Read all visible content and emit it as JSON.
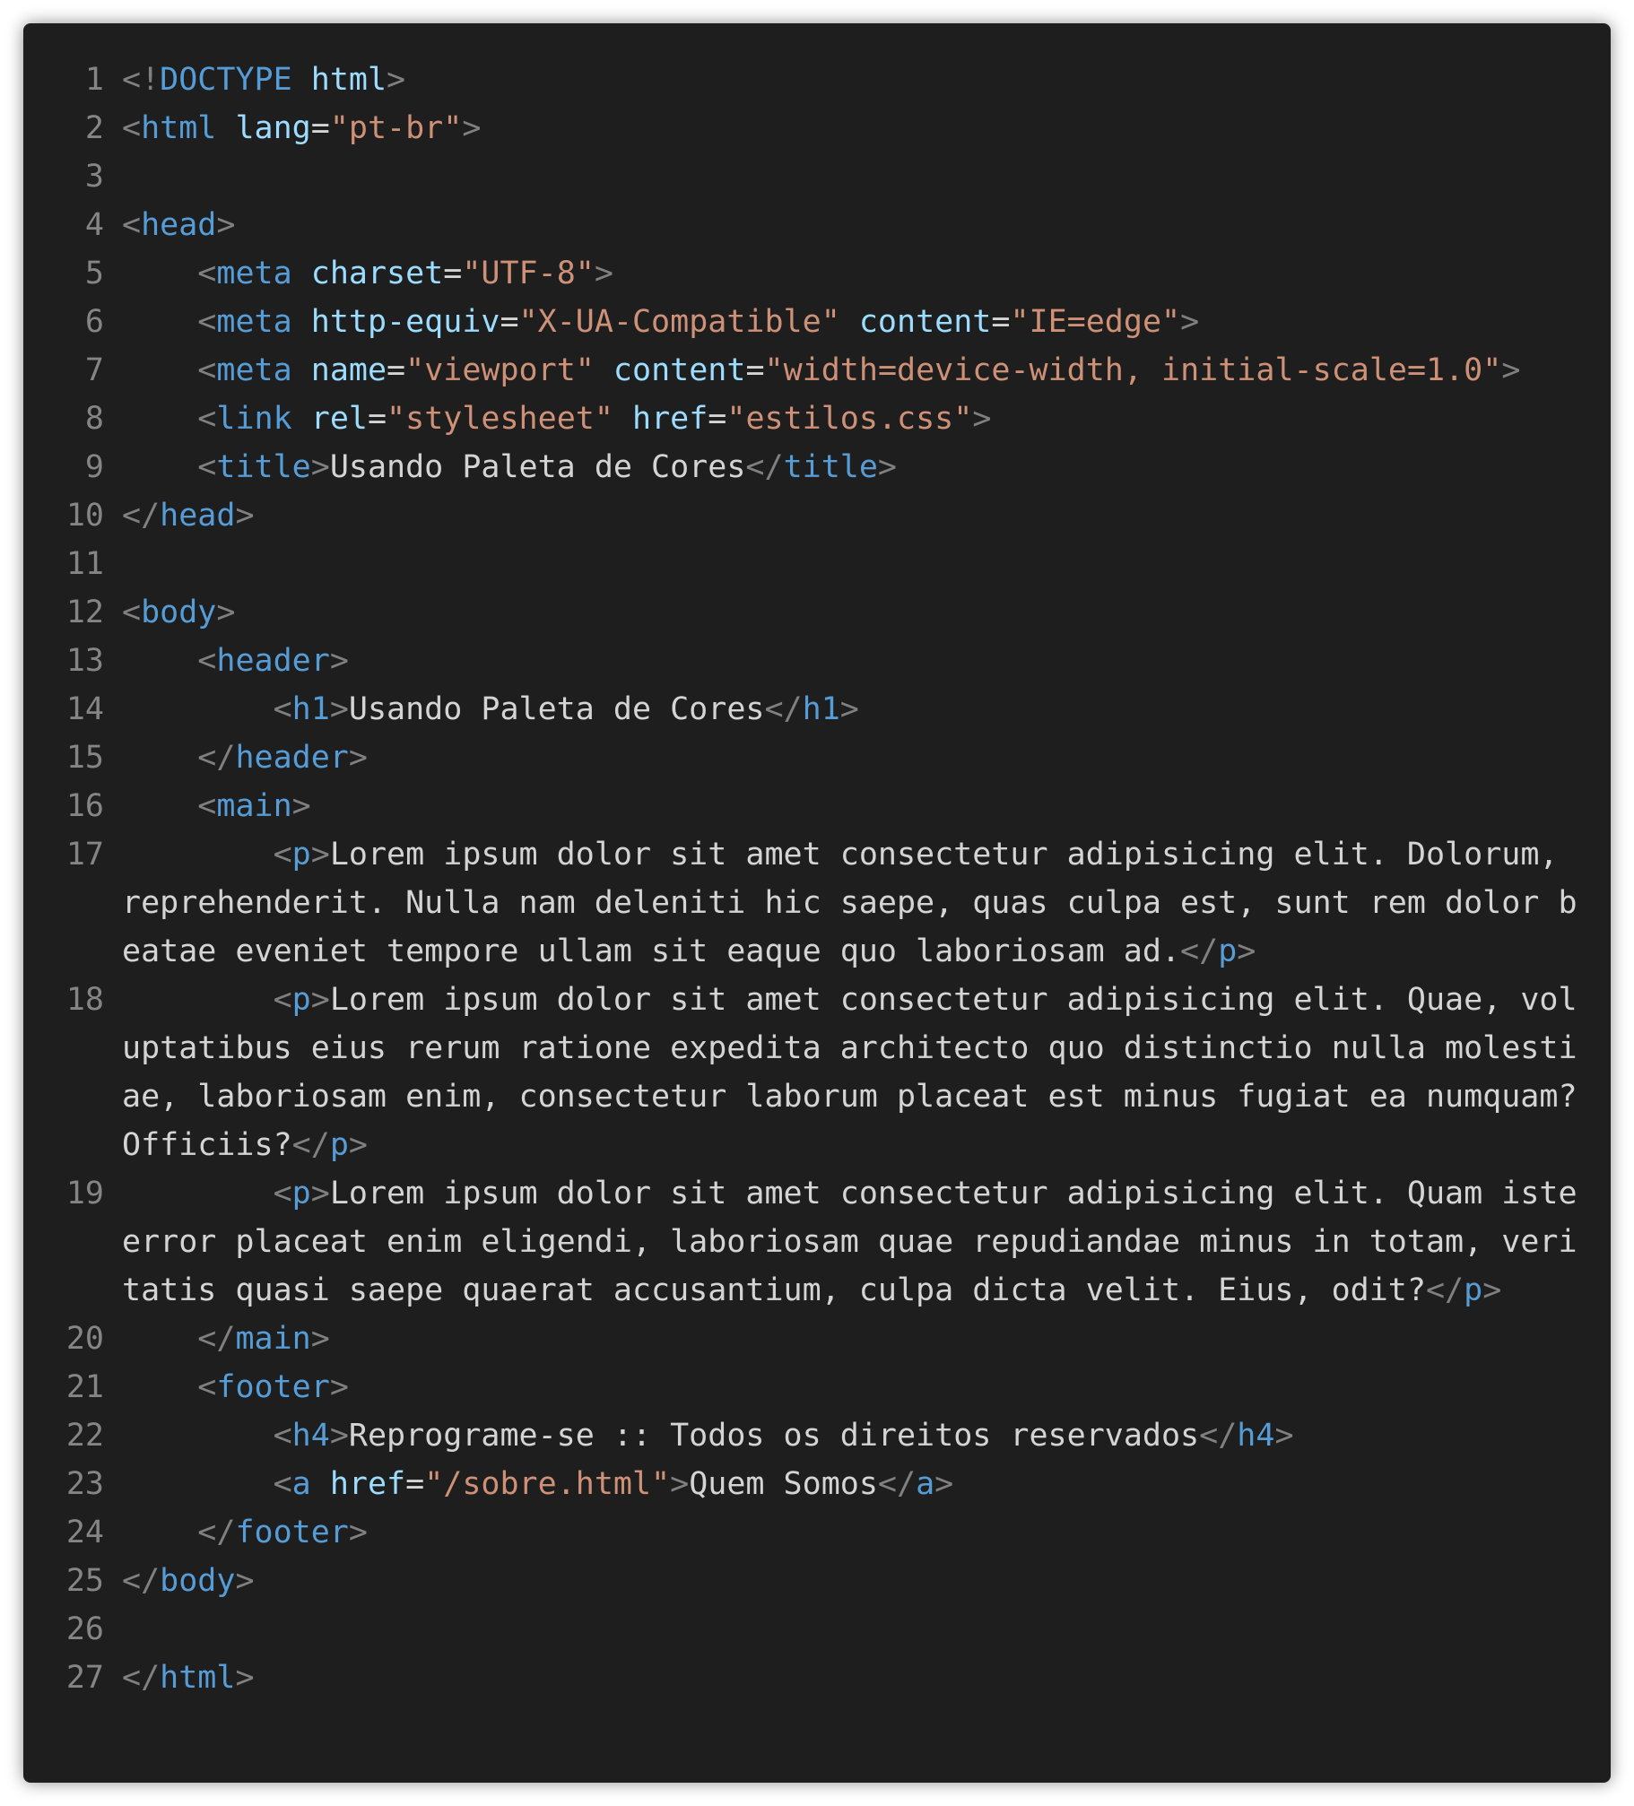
{
  "colors": {
    "background": "#1e1e1e",
    "line_number": "#858585",
    "punctuation": "#808080",
    "tag": "#569cd6",
    "attribute": "#9cdcfe",
    "string": "#ce9178",
    "text": "#d4d4d4"
  },
  "lines": [
    {
      "n": "1",
      "tokens": [
        [
          "punct",
          "<!"
        ],
        [
          "tag",
          "DOCTYPE"
        ],
        [
          "text",
          " "
        ],
        [
          "attr",
          "html"
        ],
        [
          "punct",
          ">"
        ]
      ]
    },
    {
      "n": "2",
      "tokens": [
        [
          "punct",
          "<"
        ],
        [
          "tag",
          "html"
        ],
        [
          "text",
          " "
        ],
        [
          "attr",
          "lang"
        ],
        [
          "eq",
          "="
        ],
        [
          "str",
          "\"pt-br\""
        ],
        [
          "punct",
          ">"
        ]
      ]
    },
    {
      "n": "3",
      "tokens": []
    },
    {
      "n": "4",
      "tokens": [
        [
          "punct",
          "<"
        ],
        [
          "tag",
          "head"
        ],
        [
          "punct",
          ">"
        ]
      ]
    },
    {
      "n": "5",
      "tokens": [
        [
          "text",
          "    "
        ],
        [
          "punct",
          "<"
        ],
        [
          "tag",
          "meta"
        ],
        [
          "text",
          " "
        ],
        [
          "attr",
          "charset"
        ],
        [
          "eq",
          "="
        ],
        [
          "str",
          "\"UTF-8\""
        ],
        [
          "punct",
          ">"
        ]
      ]
    },
    {
      "n": "6",
      "tokens": [
        [
          "text",
          "    "
        ],
        [
          "punct",
          "<"
        ],
        [
          "tag",
          "meta"
        ],
        [
          "text",
          " "
        ],
        [
          "attr",
          "http-equiv"
        ],
        [
          "eq",
          "="
        ],
        [
          "str",
          "\"X-UA-Compatible\""
        ],
        [
          "text",
          " "
        ],
        [
          "attr",
          "content"
        ],
        [
          "eq",
          "="
        ],
        [
          "str",
          "\"IE=edge\""
        ],
        [
          "punct",
          ">"
        ]
      ]
    },
    {
      "n": "7",
      "tokens": [
        [
          "text",
          "    "
        ],
        [
          "punct",
          "<"
        ],
        [
          "tag",
          "meta"
        ],
        [
          "text",
          " "
        ],
        [
          "attr",
          "name"
        ],
        [
          "eq",
          "="
        ],
        [
          "str",
          "\"viewport\""
        ],
        [
          "text",
          " "
        ],
        [
          "attr",
          "content"
        ],
        [
          "eq",
          "="
        ],
        [
          "str",
          "\"width=device-width, initial-scale=1.0\""
        ],
        [
          "punct",
          ">"
        ]
      ]
    },
    {
      "n": "8",
      "tokens": [
        [
          "text",
          "    "
        ],
        [
          "punct",
          "<"
        ],
        [
          "tag",
          "link"
        ],
        [
          "text",
          " "
        ],
        [
          "attr",
          "rel"
        ],
        [
          "eq",
          "="
        ],
        [
          "str",
          "\"stylesheet\""
        ],
        [
          "text",
          " "
        ],
        [
          "attr",
          "href"
        ],
        [
          "eq",
          "="
        ],
        [
          "str",
          "\"estilos.css\""
        ],
        [
          "punct",
          ">"
        ]
      ]
    },
    {
      "n": "9",
      "tokens": [
        [
          "text",
          "    "
        ],
        [
          "punct",
          "<"
        ],
        [
          "tag",
          "title"
        ],
        [
          "punct",
          ">"
        ],
        [
          "text",
          "Usando Paleta de Cores"
        ],
        [
          "punct",
          "</"
        ],
        [
          "tag",
          "title"
        ],
        [
          "punct",
          ">"
        ]
      ]
    },
    {
      "n": "10",
      "tokens": [
        [
          "punct",
          "</"
        ],
        [
          "tag",
          "head"
        ],
        [
          "punct",
          ">"
        ]
      ]
    },
    {
      "n": "11",
      "tokens": []
    },
    {
      "n": "12",
      "tokens": [
        [
          "punct",
          "<"
        ],
        [
          "tag",
          "body"
        ],
        [
          "punct",
          ">"
        ]
      ]
    },
    {
      "n": "13",
      "tokens": [
        [
          "text",
          "    "
        ],
        [
          "punct",
          "<"
        ],
        [
          "tag",
          "header"
        ],
        [
          "punct",
          ">"
        ]
      ]
    },
    {
      "n": "14",
      "tokens": [
        [
          "text",
          "        "
        ],
        [
          "punct",
          "<"
        ],
        [
          "tag",
          "h1"
        ],
        [
          "punct",
          ">"
        ],
        [
          "text",
          "Usando Paleta de Cores"
        ],
        [
          "punct",
          "</"
        ],
        [
          "tag",
          "h1"
        ],
        [
          "punct",
          ">"
        ]
      ]
    },
    {
      "n": "15",
      "tokens": [
        [
          "text",
          "    "
        ],
        [
          "punct",
          "</"
        ],
        [
          "tag",
          "header"
        ],
        [
          "punct",
          ">"
        ]
      ]
    },
    {
      "n": "16",
      "tokens": [
        [
          "text",
          "    "
        ],
        [
          "punct",
          "<"
        ],
        [
          "tag",
          "main"
        ],
        [
          "punct",
          ">"
        ]
      ]
    },
    {
      "n": "17",
      "tokens": [
        [
          "text",
          "        "
        ],
        [
          "punct",
          "<"
        ],
        [
          "tag",
          "p"
        ],
        [
          "punct",
          ">"
        ],
        [
          "text",
          "Lorem ipsum dolor sit amet consectetur adipisicing elit. Dolorum, reprehenderit. Nulla nam deleniti hic saepe, quas culpa est, sunt rem dolor beatae eveniet tempore ullam sit eaque quo laboriosam ad."
        ],
        [
          "punct",
          "</"
        ],
        [
          "tag",
          "p"
        ],
        [
          "punct",
          ">"
        ]
      ]
    },
    {
      "n": "18",
      "tokens": [
        [
          "text",
          "        "
        ],
        [
          "punct",
          "<"
        ],
        [
          "tag",
          "p"
        ],
        [
          "punct",
          ">"
        ],
        [
          "text",
          "Lorem ipsum dolor sit amet consectetur adipisicing elit. Quae, voluptatibus eius rerum ratione expedita architecto quo distinctio nulla molestiae, laboriosam enim, consectetur laborum placeat est minus fugiat ea numquam? Officiis?"
        ],
        [
          "punct",
          "</"
        ],
        [
          "tag",
          "p"
        ],
        [
          "punct",
          ">"
        ]
      ]
    },
    {
      "n": "19",
      "tokens": [
        [
          "text",
          "        "
        ],
        [
          "punct",
          "<"
        ],
        [
          "tag",
          "p"
        ],
        [
          "punct",
          ">"
        ],
        [
          "text",
          "Lorem ipsum dolor sit amet consectetur adipisicing elit. Quam iste error placeat enim eligendi, laboriosam quae repudiandae minus in totam, veritatis quasi saepe quaerat accusantium, culpa dicta velit. Eius, odit?"
        ],
        [
          "punct",
          "</"
        ],
        [
          "tag",
          "p"
        ],
        [
          "punct",
          ">"
        ]
      ]
    },
    {
      "n": "20",
      "tokens": [
        [
          "text",
          "    "
        ],
        [
          "punct",
          "</"
        ],
        [
          "tag",
          "main"
        ],
        [
          "punct",
          ">"
        ]
      ]
    },
    {
      "n": "21",
      "tokens": [
        [
          "text",
          "    "
        ],
        [
          "punct",
          "<"
        ],
        [
          "tag",
          "footer"
        ],
        [
          "punct",
          ">"
        ]
      ]
    },
    {
      "n": "22",
      "tokens": [
        [
          "text",
          "        "
        ],
        [
          "punct",
          "<"
        ],
        [
          "tag",
          "h4"
        ],
        [
          "punct",
          ">"
        ],
        [
          "text",
          "Reprograme-se :: Todos os direitos reservados"
        ],
        [
          "punct",
          "</"
        ],
        [
          "tag",
          "h4"
        ],
        [
          "punct",
          ">"
        ]
      ]
    },
    {
      "n": "23",
      "tokens": [
        [
          "text",
          "        "
        ],
        [
          "punct",
          "<"
        ],
        [
          "tag",
          "a"
        ],
        [
          "text",
          " "
        ],
        [
          "attr",
          "href"
        ],
        [
          "eq",
          "="
        ],
        [
          "str",
          "\"/sobre.html\""
        ],
        [
          "punct",
          ">"
        ],
        [
          "text",
          "Quem Somos"
        ],
        [
          "punct",
          "</"
        ],
        [
          "tag",
          "a"
        ],
        [
          "punct",
          ">"
        ]
      ]
    },
    {
      "n": "24",
      "tokens": [
        [
          "text",
          "    "
        ],
        [
          "punct",
          "</"
        ],
        [
          "tag",
          "footer"
        ],
        [
          "punct",
          ">"
        ]
      ]
    },
    {
      "n": "25",
      "tokens": [
        [
          "punct",
          "</"
        ],
        [
          "tag",
          "body"
        ],
        [
          "punct",
          ">"
        ]
      ]
    },
    {
      "n": "26",
      "tokens": []
    },
    {
      "n": "27",
      "tokens": [
        [
          "punct",
          "</"
        ],
        [
          "tag",
          "html"
        ],
        [
          "punct",
          ">"
        ]
      ]
    }
  ]
}
